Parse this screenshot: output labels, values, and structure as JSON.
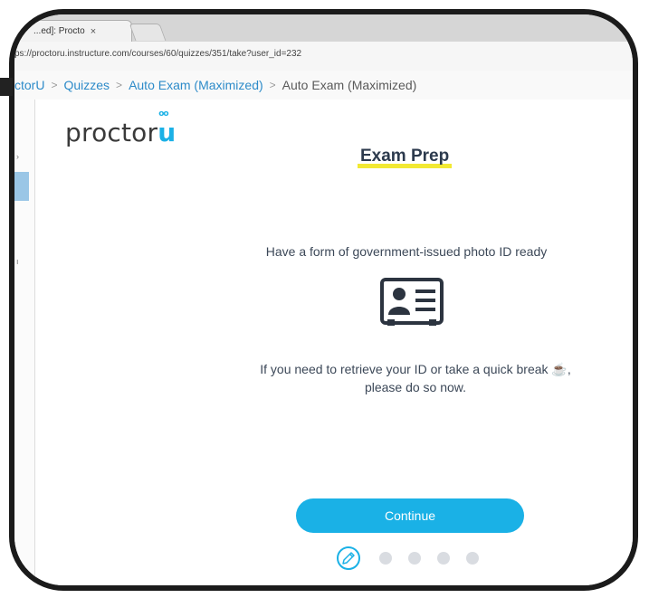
{
  "browser": {
    "tab_title": "...ed]: Procto",
    "tab_close": "×",
    "url": "ps://proctoru.instructure.com/courses/60/quizzes/351/take?user_id=232"
  },
  "breadcrumb": {
    "items": [
      "ctorU",
      "Quizzes",
      "Auto Exam (Maximized)",
      "Auto Exam (Maximized)"
    ],
    "separator": ">"
  },
  "logo": {
    "text_main": "proctor",
    "text_u": "u",
    "eyes": "oo"
  },
  "exam_prep": {
    "title": "Exam Prep",
    "instruction": "Have a form of government-issued photo ID ready",
    "retrieve_line1": "If you need to retrieve your ID or take a quick break ☕,",
    "retrieve_line2": "please do so now.",
    "continue_label": "Continue"
  },
  "icons": {
    "id_card": "id-card-icon",
    "step": "pencil-icon"
  },
  "progress": {
    "current_step": 1,
    "total_steps": 5
  },
  "colors": {
    "accent": "#1ab1e6",
    "highlight": "#f2e933",
    "text": "#3c4858",
    "link": "#2d8bc9"
  }
}
